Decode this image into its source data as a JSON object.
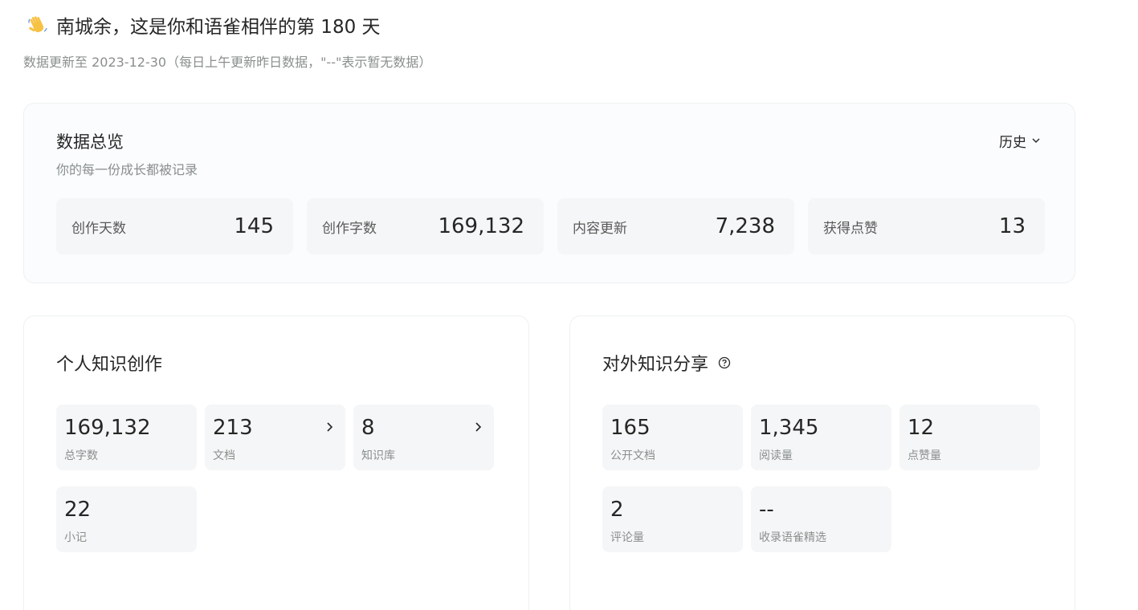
{
  "header": {
    "greeting": "南城余，这是你和语雀相伴的第 180 天",
    "subtitle": "数据更新至 2023-12-30（每日上午更新昨日数据，\"--\"表示暂无数据）",
    "greeting_icon": "waving-hand-icon"
  },
  "overview": {
    "title": "数据总览",
    "subtitle": "你的每一份成长都被记录",
    "history_label": "历史",
    "stats": [
      {
        "label": "创作天数",
        "value": "145"
      },
      {
        "label": "创作字数",
        "value": "169,132"
      },
      {
        "label": "内容更新",
        "value": "7,238"
      },
      {
        "label": "获得点赞",
        "value": "13"
      }
    ]
  },
  "personal": {
    "title": "个人知识创作",
    "tiles": [
      {
        "value": "169,132",
        "label": "总字数"
      },
      {
        "value": "213",
        "label": "文档"
      },
      {
        "value": "8",
        "label": "知识库"
      },
      {
        "value": "22",
        "label": "小记"
      }
    ]
  },
  "sharing": {
    "title": "对外知识分享",
    "tiles": [
      {
        "value": "165",
        "label": "公开文档"
      },
      {
        "value": "1,345",
        "label": "阅读量"
      },
      {
        "value": "12",
        "label": "点赞量"
      },
      {
        "value": "2",
        "label": "评论量"
      },
      {
        "value": "--",
        "label": "收录语雀精选"
      }
    ]
  }
}
